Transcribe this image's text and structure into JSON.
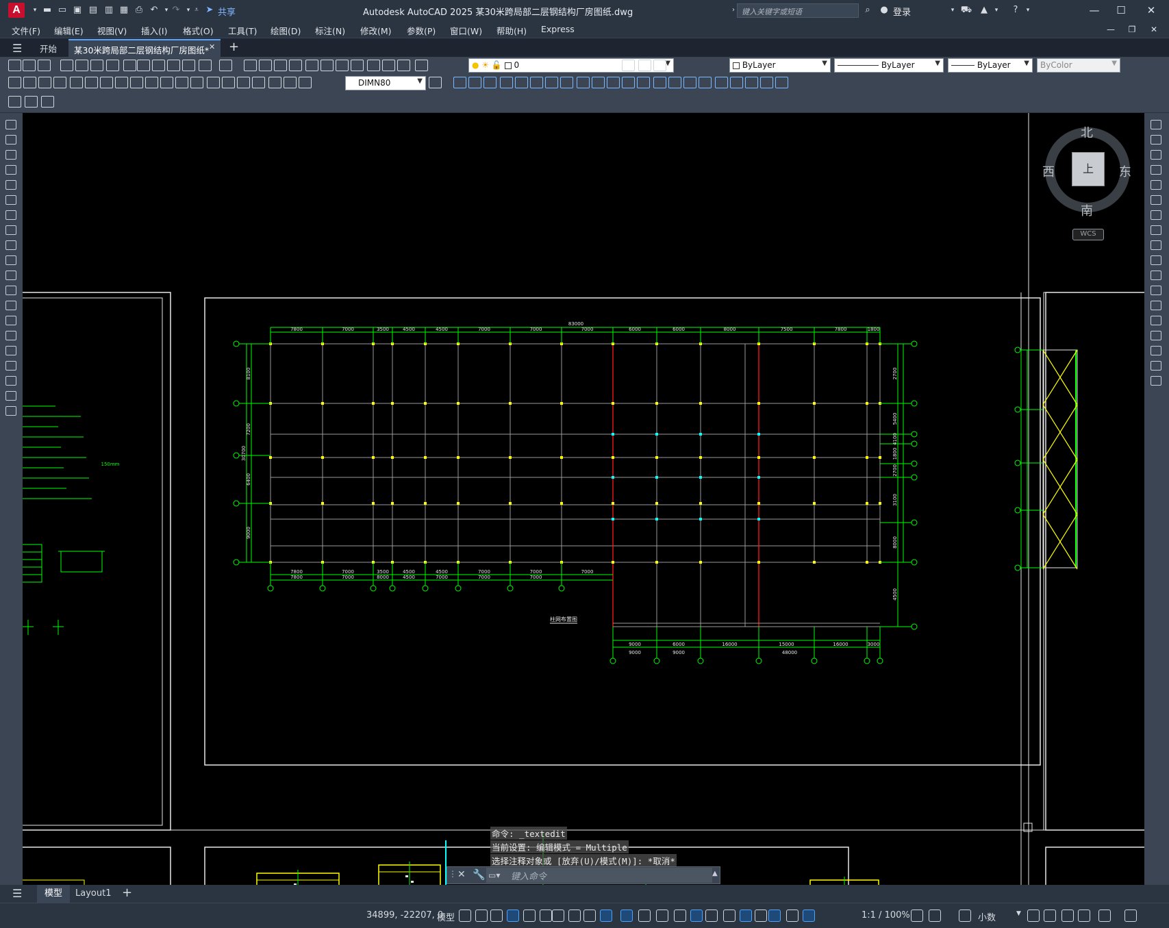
{
  "app": {
    "logo_letter": "A",
    "title": "Autodesk AutoCAD 2025    某30米跨局部二层钢结构厂房图纸.dwg",
    "share_label": "共享",
    "search_placeholder": "键入关键字或短语",
    "login_label": "登录"
  },
  "menu": [
    "文件(F)",
    "编辑(E)",
    "视图(V)",
    "插入(I)",
    "格式(O)",
    "工具(T)",
    "绘图(D)",
    "标注(N)",
    "修改(M)",
    "参数(P)",
    "窗口(W)",
    "帮助(H)",
    "Express"
  ],
  "doc_tabs": {
    "start": "开始",
    "active": "某30米跨局部二层钢结构厂房图纸*"
  },
  "toolbar": {
    "layer_value": "0",
    "color_value": "ByLayer",
    "linetype_value": "ByLayer",
    "lineweight_value": "ByLayer",
    "plotstyle_value": "ByColor",
    "dimstyle_value": "DIMN80"
  },
  "viewcube": {
    "north": "北",
    "south": "南",
    "east": "东",
    "west": "西",
    "top_face": "上",
    "wcs": "WCS"
  },
  "drawing": {
    "plan_title": "柱网布置图",
    "top_total_dim": "83000",
    "top_dims": [
      "7800",
      "7000",
      "3500",
      "4500",
      "4500",
      "7000",
      "7000",
      "7000",
      "6000",
      "6000",
      "8000",
      "7500",
      "7800",
      "1800"
    ],
    "bottom_dims_row1": [
      "7800",
      "7000",
      "3500",
      "4500",
      "4500",
      "7000",
      "7000",
      "7000"
    ],
    "bottom_dims_row2": [
      "7800",
      "7000",
      "8000",
      "4500",
      "7000",
      "7000",
      "7000"
    ],
    "lower_dims": [
      "9000",
      "6000",
      "16000",
      "15000",
      "16000",
      "3000"
    ],
    "lower_dims_row2": [
      "9000",
      "9000",
      "48000"
    ],
    "left_dims": [
      "8100",
      "7200",
      "6400",
      "9000"
    ],
    "left_total": "30700",
    "right_dims": [
      "2700",
      "5400",
      "4100",
      "1800",
      "2700",
      "3100",
      "8000",
      "4500",
      "5400",
      "18900"
    ],
    "note_size": "150mm"
  },
  "command": {
    "history": [
      "命令: _textedit",
      "当前设置: 编辑模式 = Multiple",
      "选择注释对象或 [放弃(U)/模式(M)]: *取消*"
    ],
    "input_placeholder": "键入命令"
  },
  "layout_tabs": [
    "模型",
    "Layout1"
  ],
  "status": {
    "coords": "34899, -22207, 0",
    "model_label": "模型",
    "scale": "1:1 / 100%",
    "units": "小数"
  }
}
